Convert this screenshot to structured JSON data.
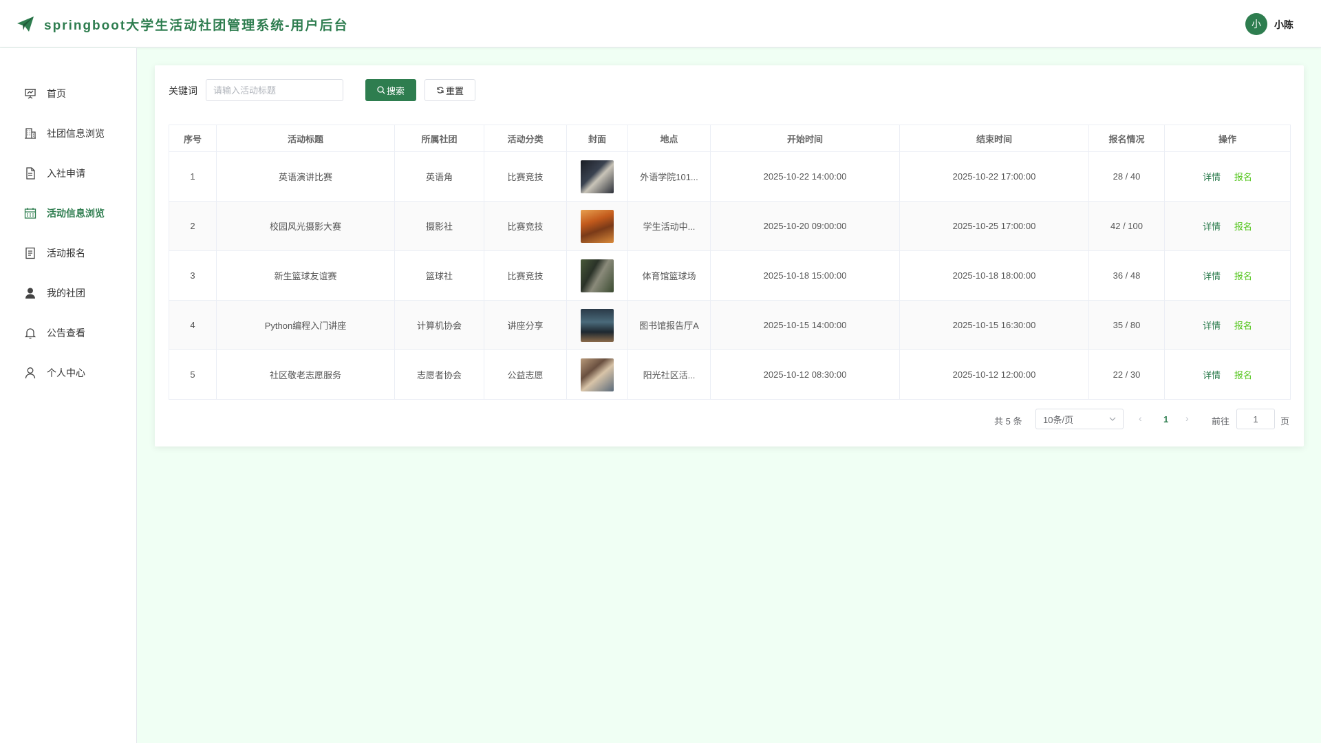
{
  "app": {
    "title": "springboot大学生活动社团管理系统-用户后台",
    "brand_color": "#2e7d4f",
    "logo_icon": "paper-plane-icon"
  },
  "user": {
    "avatar_initial": "小",
    "name": "小陈"
  },
  "sidebar": {
    "items": [
      {
        "label": "首页",
        "icon": "presentation-icon",
        "active": false
      },
      {
        "label": "社团信息浏览",
        "icon": "building-icon",
        "active": false
      },
      {
        "label": "入社申请",
        "icon": "document-icon",
        "active": false
      },
      {
        "label": "活动信息浏览",
        "icon": "calendar-icon",
        "active": true
      },
      {
        "label": "活动报名",
        "icon": "form-icon",
        "active": false
      },
      {
        "label": "我的社团",
        "icon": "user-filled-icon",
        "active": false
      },
      {
        "label": "公告查看",
        "icon": "bell-icon",
        "active": false
      },
      {
        "label": "个人中心",
        "icon": "user-icon",
        "active": false
      }
    ]
  },
  "search": {
    "label": "关键词",
    "placeholder": "请输入活动标题",
    "value": "",
    "search_button": "搜索",
    "reset_button": "重置"
  },
  "table": {
    "columns": [
      "序号",
      "活动标题",
      "所属社团",
      "活动分类",
      "封面",
      "地点",
      "开始时间",
      "结束时间",
      "报名情况",
      "操作"
    ],
    "detail_label": "详情",
    "signup_label": "报名",
    "rows": [
      {
        "index": "1",
        "title": "英语演讲比赛",
        "club": "英语角",
        "category": "比赛竞技",
        "location": "外语学院101...",
        "start": "2025-10-22 14:00:00",
        "end": "2025-10-22 17:00:00",
        "signup": "28 / 40"
      },
      {
        "index": "2",
        "title": "校园风光摄影大赛",
        "club": "摄影社",
        "category": "比赛竞技",
        "location": "学生活动中...",
        "start": "2025-10-20 09:00:00",
        "end": "2025-10-25 17:00:00",
        "signup": "42 / 100"
      },
      {
        "index": "3",
        "title": "新生篮球友谊赛",
        "club": "篮球社",
        "category": "比赛竞技",
        "location": "体育馆篮球场",
        "start": "2025-10-18 15:00:00",
        "end": "2025-10-18 18:00:00",
        "signup": "36 / 48"
      },
      {
        "index": "4",
        "title": "Python编程入门讲座",
        "club": "计算机协会",
        "category": "讲座分享",
        "location": "图书馆报告厅A",
        "start": "2025-10-15 14:00:00",
        "end": "2025-10-15 16:30:00",
        "signup": "35 / 80"
      },
      {
        "index": "5",
        "title": "社区敬老志愿服务",
        "club": "志愿者协会",
        "category": "公益志愿",
        "location": "阳光社区活...",
        "start": "2025-10-12 08:30:00",
        "end": "2025-10-12 12:00:00",
        "signup": "22 / 30"
      }
    ]
  },
  "pagination": {
    "total": "共 5 条",
    "page_size": "10条/页",
    "current_page": "1",
    "goto_label": "前往",
    "goto_value": "1",
    "page_suffix": "页"
  }
}
